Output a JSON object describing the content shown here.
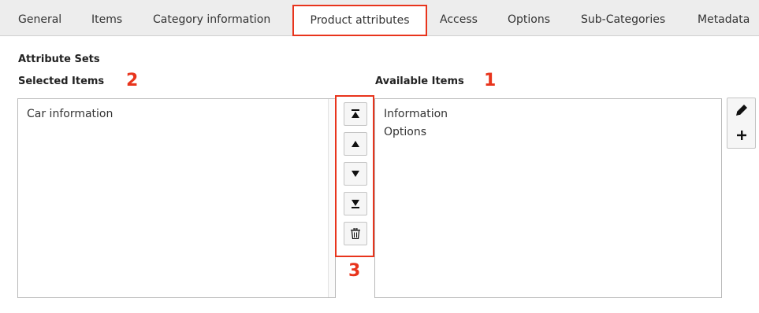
{
  "tabs": {
    "general": "General",
    "items": "Items",
    "category_information": "Category information",
    "product_attributes": "Product attributes",
    "access": "Access",
    "options": "Options",
    "sub_categories": "Sub-Categories",
    "metadata": "Metadata",
    "active": "Product attributes"
  },
  "section": {
    "title": "Attribute Sets"
  },
  "selected": {
    "label": "Selected Items",
    "marker": "2",
    "items": [
      "Car information"
    ]
  },
  "available": {
    "label": "Available Items",
    "marker": "1",
    "items": [
      "Information",
      "Options"
    ]
  },
  "controls": {
    "marker": "3",
    "buttons": [
      "move-to-top",
      "move-up",
      "move-down",
      "move-to-bottom",
      "remove"
    ]
  },
  "side_buttons": [
    "edit",
    "add"
  ],
  "colors": {
    "highlight": "#e8341c",
    "tabbar": "#ededed"
  }
}
